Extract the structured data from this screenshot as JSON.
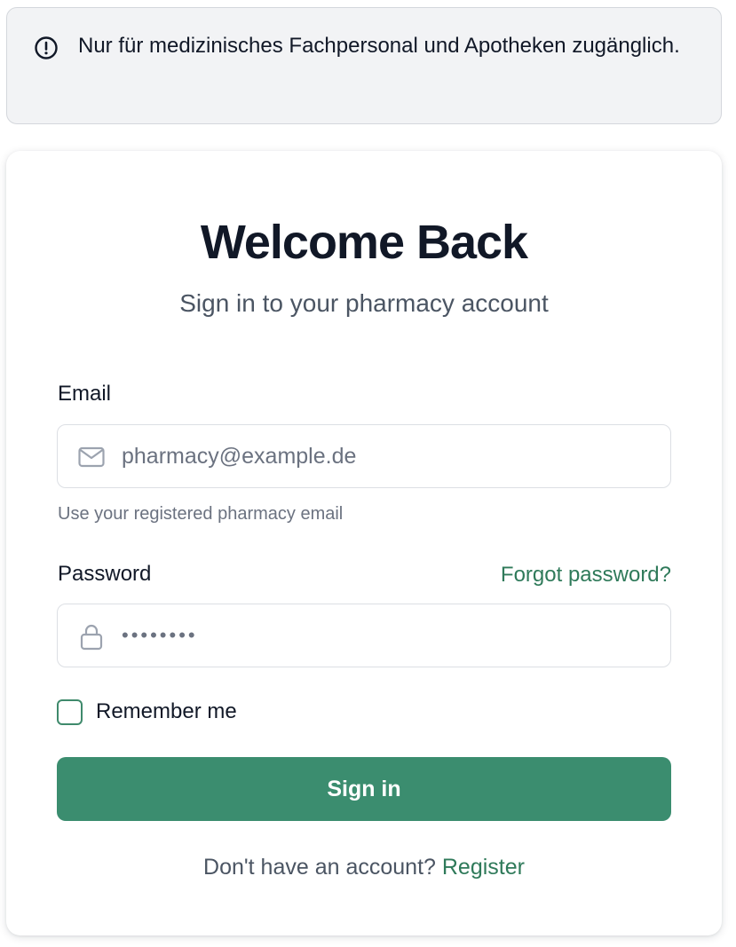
{
  "notice": {
    "icon": "alert-circle-icon",
    "text": "Nur für medizinisches Fachpersonal und Apotheken zugänglich."
  },
  "login": {
    "title": "Welcome Back",
    "subtitle": "Sign in to your pharmacy account",
    "email": {
      "label": "Email",
      "icon": "mail-icon",
      "placeholder": "pharmacy@example.de",
      "value": "",
      "hint": "Use your registered pharmacy email"
    },
    "password": {
      "label": "Password",
      "icon": "lock-icon",
      "masked_value": "••••••••",
      "forgot_link": "Forgot password?"
    },
    "remember": {
      "label": "Remember me",
      "checked": false
    },
    "signin_button": "Sign in",
    "register_prompt": "Don't have an account?",
    "register_link": "Register"
  },
  "colors": {
    "accent": "#3b8d6f",
    "link": "#2f7a5a",
    "heading": "#111827",
    "muted": "#6b7280",
    "notice_bg": "#f2f3f5"
  }
}
